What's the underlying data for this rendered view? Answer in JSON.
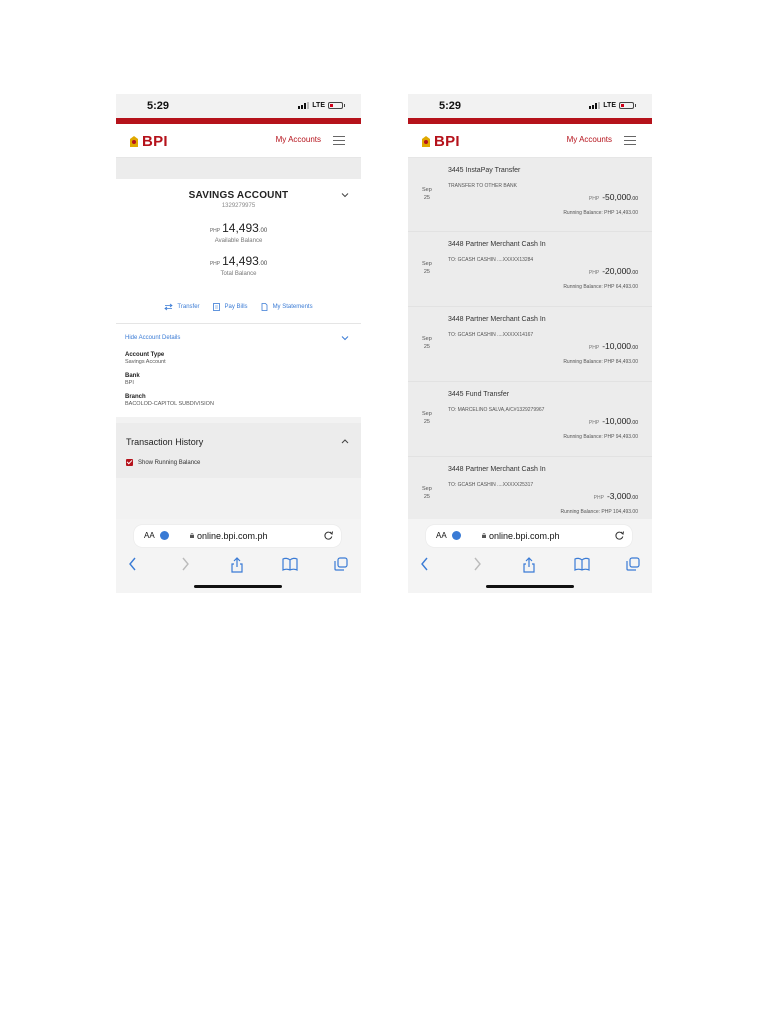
{
  "status": {
    "time": "5:29",
    "network": "LTE"
  },
  "brand": {
    "name": "BPI",
    "color": "#b5121b"
  },
  "header": {
    "my_accounts": "My Accounts"
  },
  "account": {
    "title": "SAVINGS ACCOUNT",
    "number": "1329279975",
    "available": {
      "currency": "PHP",
      "whole": "14,493",
      "dec": ".00",
      "label": "Available Balance"
    },
    "total": {
      "currency": "PHP",
      "whole": "14,493",
      "dec": ".00",
      "label": "Total Balance"
    },
    "actions": {
      "transfer": "Transfer",
      "pay_bills": "Pay Bills",
      "statements": "My Statements"
    },
    "hide_details": "Hide Account Details",
    "details": [
      {
        "key": "Account Type",
        "value": "Savings Account"
      },
      {
        "key": "Bank",
        "value": "BPI"
      },
      {
        "key": "Branch",
        "value": "BACOLOD-CAPITOL SUBDIVISION"
      }
    ]
  },
  "transaction_history": {
    "title": "Transaction History",
    "show_running": "Show Running Balance"
  },
  "browser": {
    "aa": "AA",
    "url": "online.bpi.com.ph"
  },
  "transactions": [
    {
      "title": "3445 InstaPay Transfer",
      "desc": "TRANSFER TO OTHER BANK",
      "month": "Sep",
      "day": "25",
      "currency": "PHP",
      "amount": "-50,000",
      "dec": ".00",
      "running": "Running Balance: PHP 14,493.00"
    },
    {
      "title": "3448 Partner Merchant Cash In",
      "desc": "TO: GCASH CASHIN ....XXXXX13284",
      "month": "Sep",
      "day": "25",
      "currency": "PHP",
      "amount": "-20,000",
      "dec": ".00",
      "running": "Running Balance: PHP 64,493.00"
    },
    {
      "title": "3448 Partner Merchant Cash In",
      "desc": "TO: GCASH CASHIN ....XXXXX14167",
      "month": "Sep",
      "day": "25",
      "currency": "PHP",
      "amount": "-10,000",
      "dec": ".00",
      "running": "Running Balance: PHP 84,493.00"
    },
    {
      "title": "3445 Fund Transfer",
      "desc": "TO: MARCELINO SALVA,A/C#1329279967",
      "month": "Sep",
      "day": "25",
      "currency": "PHP",
      "amount": "-10,000",
      "dec": ".00",
      "running": "Running Balance: PHP 94,493.00"
    },
    {
      "title": "3448 Partner Merchant Cash In",
      "desc": "TO: GCASH CASHIN ....XXXXX25317",
      "month": "Sep",
      "day": "25",
      "currency": "PHP",
      "amount": "-3,000",
      "dec": ".00",
      "running": "Running Balance: PHP 104,493.00"
    }
  ]
}
